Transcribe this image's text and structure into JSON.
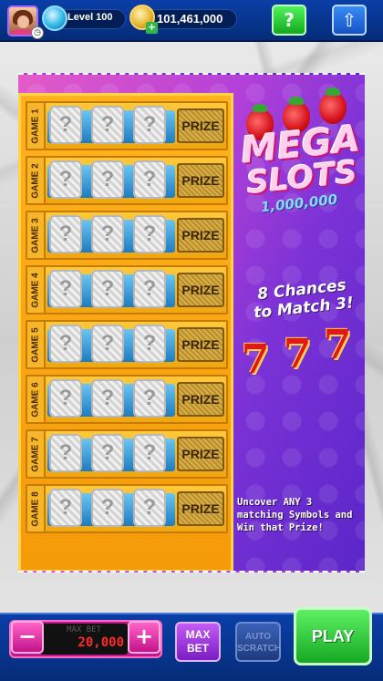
{
  "topbar": {
    "level": "Level 100",
    "coins": "101,461,000",
    "help_label": "?",
    "up_label": "⇧"
  },
  "ticket": {
    "title_line1": "MEGA",
    "title_line2": "SLOTS",
    "jackpot": "1,000,000",
    "chances_line1": "8 Chances",
    "chances_line2": "to Match 3!",
    "sevens": [
      "7",
      "7",
      "7"
    ],
    "uncover_text": "Uncover ANY 3 matching Symbols and Win that Prize!",
    "games": [
      {
        "label": "GAME 1",
        "symbols": [
          "?",
          "?",
          "?"
        ],
        "prize": "PRIZE"
      },
      {
        "label": "GAME 2",
        "symbols": [
          "?",
          "?",
          "?"
        ],
        "prize": "PRIZE"
      },
      {
        "label": "GAME 3",
        "symbols": [
          "?",
          "?",
          "?"
        ],
        "prize": "PRIZE"
      },
      {
        "label": "GAME 4",
        "symbols": [
          "?",
          "?",
          "?"
        ],
        "prize": "PRIZE"
      },
      {
        "label": "GAME 5",
        "symbols": [
          "?",
          "?",
          "?"
        ],
        "prize": "PRIZE"
      },
      {
        "label": "GAME 6",
        "symbols": [
          "?",
          "?",
          "?"
        ],
        "prize": "PRIZE"
      },
      {
        "label": "GAME 7",
        "symbols": [
          "?",
          "?",
          "?"
        ],
        "prize": "PRIZE"
      },
      {
        "label": "GAME 8",
        "symbols": [
          "?",
          "?",
          "?"
        ],
        "prize": "PRIZE"
      }
    ]
  },
  "bottombar": {
    "minus_label": "−",
    "plus_label": "+",
    "maxbet_caption": "MAX BET",
    "bet_value": "20,000",
    "maxbet_button": "MAX BET",
    "auto_button": "AUTO SCRATCH",
    "play_button": "PLAY"
  },
  "colors": {
    "accent_blue": "#0a3fa8",
    "play_green": "#17a823",
    "ticket_purple": "#7b32d6"
  }
}
